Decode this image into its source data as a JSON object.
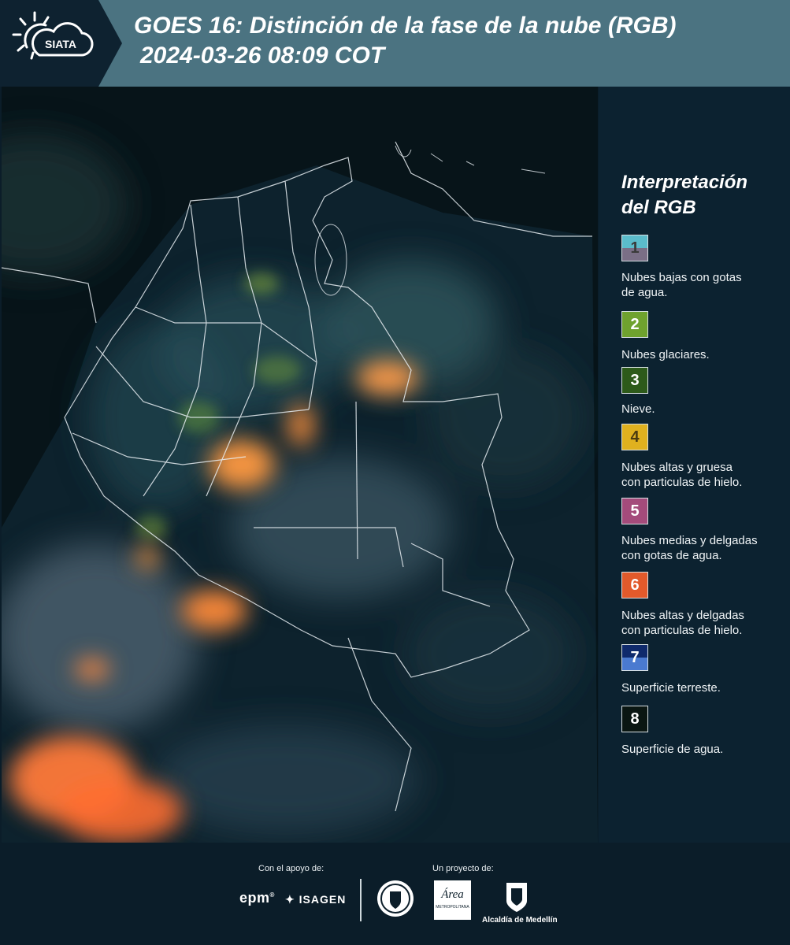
{
  "header": {
    "logo_text": "SIATA",
    "title_line1": "GOES 16: Distinción de la fase de la nube (RGB)",
    "title_line2": "2024-03-26 08:09 COT"
  },
  "legend": {
    "title_line1": "Interpretación",
    "title_line2": "del RGB",
    "items": [
      {
        "number": "1",
        "label_line1": "Nubes bajas con gotas",
        "label_line2": "de agua.",
        "color_top": "#5bbccb",
        "color_bottom": "#7a6f86",
        "number_color": "#3a3a3a"
      },
      {
        "number": "2",
        "label_line1": "Nubes glaciares.",
        "label_line2": "",
        "color_top": "#6fa22e",
        "color_bottom": "#6fa22e",
        "number_color": "#ffffff"
      },
      {
        "number": "3",
        "label_line1": "Nieve.",
        "label_line2": "",
        "color_top": "#2d5a1a",
        "color_bottom": "#2d5a1a",
        "number_color": "#ffffff"
      },
      {
        "number": "4",
        "label_line1": "Nubes altas y gruesa",
        "label_line2": "con particulas de hielo.",
        "color_top": "#e0b11f",
        "color_bottom": "#e0b11f",
        "number_color": "#4a3a10"
      },
      {
        "number": "5",
        "label_line1": "Nubes medias y delgadas",
        "label_line2": "con gotas de agua.",
        "color_top": "#a44b7b",
        "color_bottom": "#a44b7b",
        "number_color": "#ffffff"
      },
      {
        "number": "6",
        "label_line1": "Nubes altas y delgadas",
        "label_line2": "con particulas de hielo.",
        "color_top": "#e25a2b",
        "color_bottom": "#e25a2b",
        "number_color": "#ffffff"
      },
      {
        "number": "7",
        "label_line1": "Superficie terreste.",
        "label_line2": "",
        "color_top": "#0f2a6c",
        "color_bottom": "#4a7ad0",
        "number_color": "#ffffff"
      },
      {
        "number": "8",
        "label_line1": "Superficie de agua.",
        "label_line2": "",
        "color_top": "#0a1612",
        "color_bottom": "#0a1612",
        "number_color": "#ffffff"
      }
    ]
  },
  "footer": {
    "support_label": "Con el apoyo de:",
    "project_label": "Un proyecto de:",
    "epm_text": "epm",
    "isagen_text": "ISAGEN",
    "area_text": "Área",
    "area_subtext": "METROPOLITANA",
    "alcaldia_text": "Alcaldía de Medellín"
  }
}
